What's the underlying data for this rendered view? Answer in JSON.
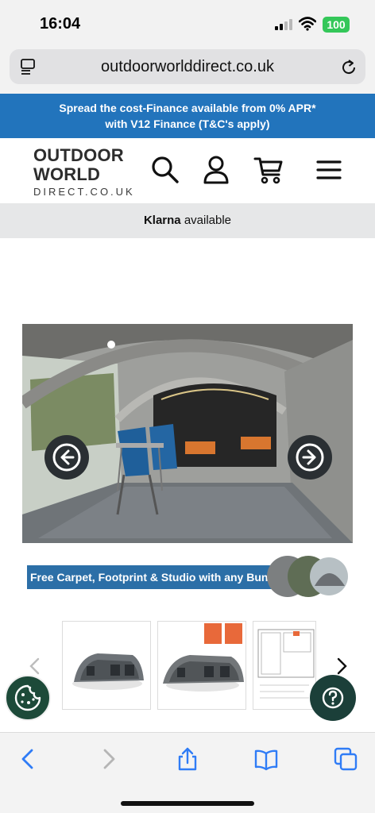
{
  "status": {
    "time": "16:04",
    "battery": "100"
  },
  "browser": {
    "url": "outdoorworlddirect.co.uk"
  },
  "promo": {
    "line1": "Spread the cost-Finance available from 0% APR*",
    "line2": "with V12 Finance (T&C's apply)"
  },
  "header": {
    "logo_line1": "OUTDOOR",
    "logo_line2": "WORLD",
    "logo_line3": "DIRECT.CO.UK"
  },
  "klarna": {
    "brand": "Klarna",
    "text": "available"
  },
  "gallery": {
    "bundle_text": "Free Carpet, Footprint & Studio with any Bundle"
  },
  "colors": {
    "promo_bg": "#2274bc",
    "klarna_bg": "#e6e7e8",
    "bundle_bg": "#2c6fa7",
    "cookie_bg": "#1d4a39",
    "help_bg": "#1b3f39",
    "ios_blue": "#2f7cf6"
  },
  "icons": {
    "header": [
      "search-icon",
      "account-icon",
      "cart-icon",
      "menu-icon"
    ],
    "toolbar": [
      "back-icon",
      "forward-icon",
      "share-icon",
      "bookmarks-icon",
      "tabs-icon"
    ]
  }
}
